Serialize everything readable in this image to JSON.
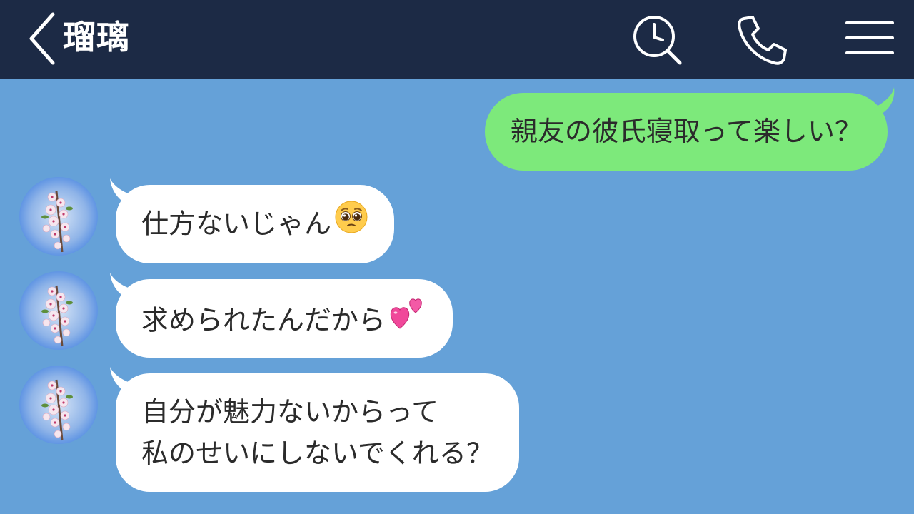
{
  "header": {
    "contact_name": "瑠璃",
    "back_icon": "chevron-left-icon",
    "search_icon": "clock-search-icon",
    "call_icon": "phone-icon",
    "menu_icon": "hamburger-menu-icon"
  },
  "colors": {
    "header_bg": "#1c2a45",
    "chat_bg": "#65a1d8",
    "outgoing_bubble": "#7de97b",
    "incoming_bubble": "#ffffff",
    "text": "#2b2b2b"
  },
  "messages": [
    {
      "direction": "outgoing",
      "text": "親友の彼氏寝取って楽しい？"
    },
    {
      "direction": "incoming",
      "text": "仕方ないじゃん",
      "emoji": "pleading-face-emoji"
    },
    {
      "direction": "incoming",
      "text": "求められたんだから",
      "emoji": "two-hearts-emoji"
    },
    {
      "direction": "incoming",
      "lines": [
        "自分が魅力ないからって",
        "私のせいにしないでくれる？"
      ]
    }
  ]
}
